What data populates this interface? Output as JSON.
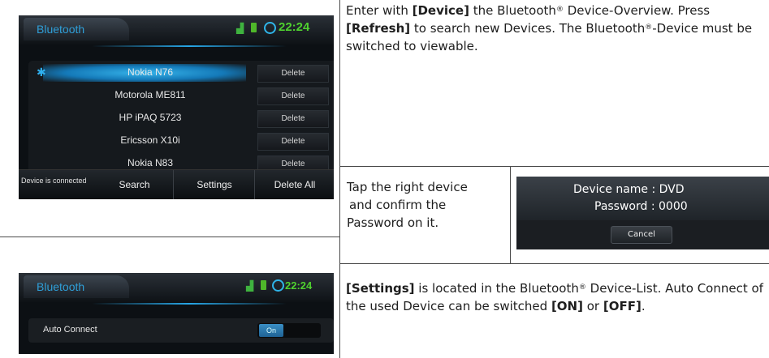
{
  "device_list_screen": {
    "title": "Bluetooth",
    "clock": "22:24",
    "devices": [
      {
        "name": "Nokia N76",
        "delete_label": "Delete"
      },
      {
        "name": "Motorola ME811",
        "delete_label": "Delete"
      },
      {
        "name": "HP iPAQ 5723",
        "delete_label": "Delete"
      },
      {
        "name": "Ericsson X10i",
        "delete_label": "Delete"
      },
      {
        "name": "Nokia N83",
        "delete_label": "Delete"
      }
    ],
    "status": "Device is connected",
    "buttons": {
      "search": "Search",
      "settings": "Settings",
      "delete_all": "Delete All"
    },
    "icons": {
      "bluetooth": "bluetooth-icon",
      "signal": "signal-icon",
      "battery": "battery-icon",
      "clock": "clock-icon"
    }
  },
  "pairing_dialog": {
    "device_name_line": "Device name  : DVD",
    "password_line": "Password  : 0000",
    "cancel_label": "Cancel"
  },
  "settings_screen": {
    "title": "Bluetooth",
    "clock": "22:24",
    "auto_connect_label": "Auto Connect",
    "toggle_state": "On"
  },
  "descriptions": {
    "overview": {
      "p1": "Enter with ",
      "k1": "[Device]",
      "p2": " the Bluetooth",
      "reg1": "®",
      "p3": " Device-Overview. Press ",
      "k2": "[Refresh]",
      "p4": " to search new Devices. The Bluetooth",
      "reg2": "®",
      "p5": "-Device must be switched to viewable."
    },
    "pairing": {
      "line1": "Tap the right device",
      "line2": "and confirm the",
      "line3": "Password on it."
    },
    "settings": {
      "k1": "[Settings]",
      "p1": " is located in the Bluetooth",
      "reg": "®",
      "p2": " Device-List. Auto Connect of the used Device can be switched ",
      "k2": "[ON]",
      "p3": " or ",
      "k3": "[OFF]",
      "p4": "."
    }
  }
}
